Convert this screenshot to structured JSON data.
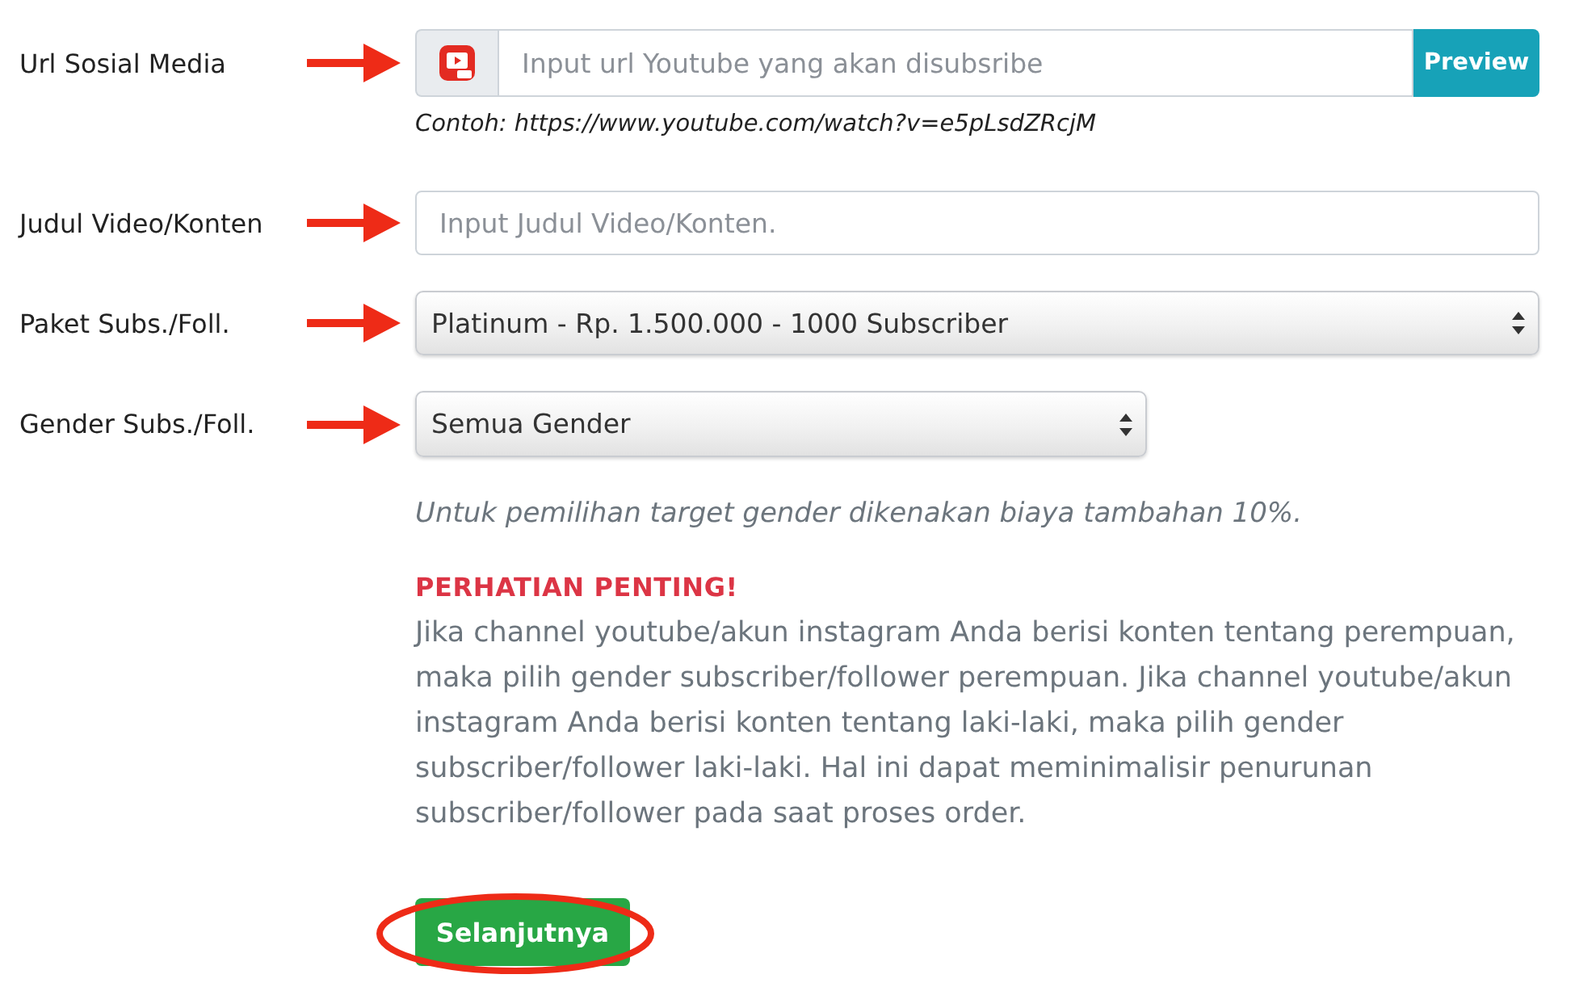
{
  "fields": [
    {
      "kind": "url-input",
      "label": "Url Sosial Media",
      "arrow": true,
      "placeholder": "Input url Youtube yang akan disubsribe",
      "button": "Preview",
      "hint": "Contoh: https://www.youtube.com/watch?v=e5pLsdZRcjM"
    },
    {
      "kind": "text-input",
      "label": "Judul Video/Konten",
      "arrow": true,
      "placeholder": "Input Judul Video/Konten."
    },
    {
      "kind": "select",
      "label": "Paket Subs./Foll.",
      "arrow": true,
      "value": "Platinum - Rp. 1.500.000 - 1000 Subscriber"
    },
    {
      "kind": "select",
      "label": "Gender Subs./Foll.",
      "arrow": true,
      "value": "Semua Gender"
    }
  ],
  "note": "Untuk pemilihan target gender dikenakan biaya tambahan 10%.",
  "warning": {
    "title": "PERHATIAN PENTING!",
    "text": "Jika channel youtube/akun instagram Anda berisi konten tentang perempuan, maka pilih gender subscriber/follower perempuan. Jika channel youtube/akun instagram Anda berisi konten tentang laki-laki, maka pilih gender subscriber/follower laki-laki. Hal ini dapat meminimalisir penurunan subscriber/follower pada saat proses order."
  },
  "submit": {
    "label": "Selanjutnya",
    "circled": true
  }
}
